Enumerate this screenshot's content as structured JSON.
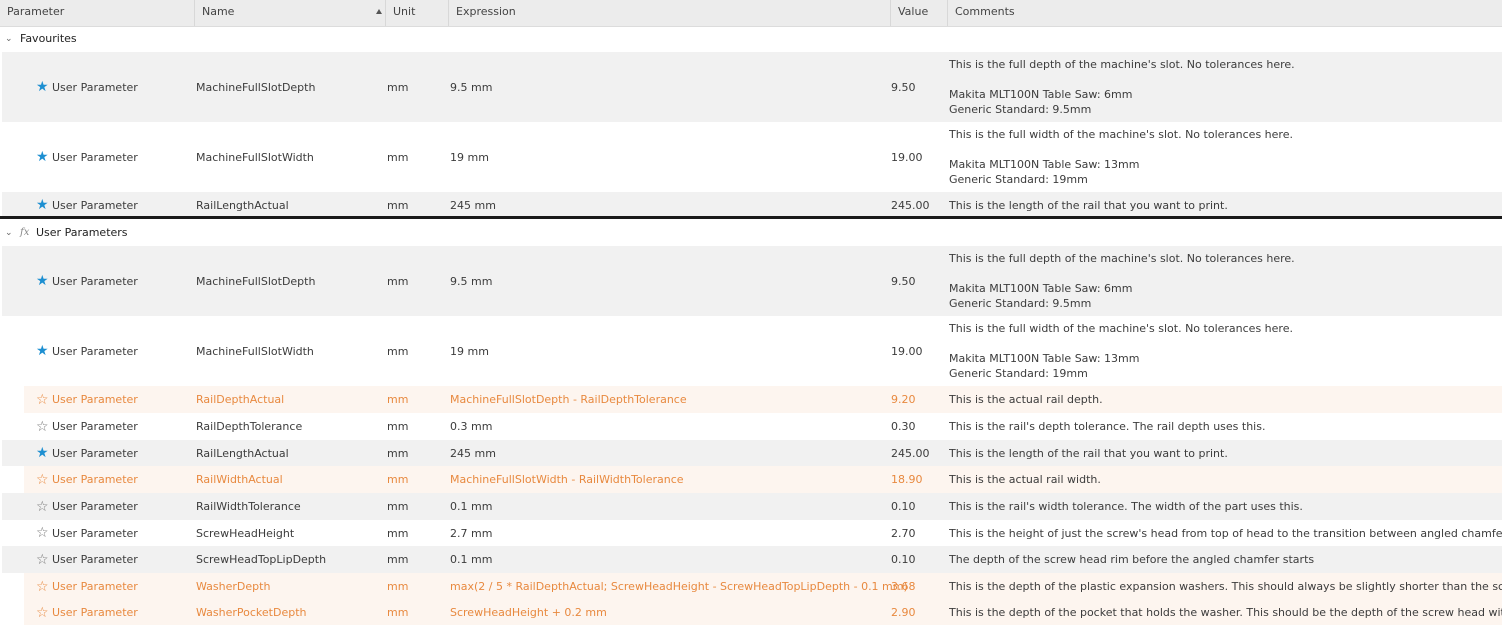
{
  "columns": [
    "Parameter",
    "Name",
    "Unit",
    "Expression",
    "Value",
    "Comments"
  ],
  "groups": [
    {
      "title": "Favourites",
      "rows": [
        {
          "style": "gray",
          "star": "filled",
          "param": "User Parameter",
          "name": "MachineFullSlotDepth",
          "unit": "mm",
          "expr": "9.5 mm",
          "value": "9.50",
          "comment": [
            "This is the full depth of the machine's slot. No tolerances here.",
            "",
            "Makita MLT100N Table Saw: 6mm",
            "Generic Standard: 9.5mm"
          ]
        },
        {
          "style": "white",
          "star": "filled",
          "param": "User Parameter",
          "name": "MachineFullSlotWidth",
          "unit": "mm",
          "expr": "19 mm",
          "value": "19.00",
          "comment": [
            "This is the full width of the machine's slot. No tolerances here.",
            "",
            "Makita MLT100N Table Saw: 13mm",
            "Generic Standard: 19mm"
          ]
        },
        {
          "style": "gray",
          "star": "filled",
          "param": "User Parameter",
          "name": "RailLengthActual",
          "unit": "mm",
          "expr": "245 mm",
          "value": "245.00",
          "comment": [
            "This is the length of the rail that you want to print."
          ]
        }
      ]
    },
    {
      "title": "User Parameters",
      "rows": [
        {
          "style": "gray",
          "star": "filled",
          "param": "User Parameter",
          "name": "MachineFullSlotDepth",
          "unit": "mm",
          "expr": "9.5 mm",
          "value": "9.50",
          "comment": [
            "This is the full depth of the machine's slot. No tolerances here.",
            "",
            "Makita MLT100N Table Saw: 6mm",
            "Generic Standard: 9.5mm"
          ]
        },
        {
          "style": "white",
          "star": "filled",
          "param": "User Parameter",
          "name": "MachineFullSlotWidth",
          "unit": "mm",
          "expr": "19 mm",
          "value": "19.00",
          "comment": [
            "This is the full width of the machine's slot. No tolerances here.",
            "",
            "Makita MLT100N Table Saw: 13mm",
            "Generic Standard: 19mm"
          ]
        },
        {
          "style": "peach",
          "star": "empty",
          "param": "User Parameter",
          "name": "RailDepthActual",
          "unit": "mm",
          "expr": "MachineFullSlotDepth - RailDepthTolerance",
          "value": "9.20",
          "comment": [
            "This is the actual rail depth."
          ]
        },
        {
          "style": "white",
          "star": "empty",
          "param": "User Parameter",
          "name": "RailDepthTolerance",
          "unit": "mm",
          "expr": "0.3 mm",
          "value": "0.30",
          "comment": [
            "This is the rail's depth tolerance. The rail depth uses this."
          ]
        },
        {
          "style": "gray",
          "star": "filled",
          "param": "User Parameter",
          "name": "RailLengthActual",
          "unit": "mm",
          "expr": "245 mm",
          "value": "245.00",
          "comment": [
            "This is the length of the rail that you want to print."
          ]
        },
        {
          "style": "peach",
          "star": "empty",
          "param": "User Parameter",
          "name": "RailWidthActual",
          "unit": "mm",
          "expr": "MachineFullSlotWidth - RailWidthTolerance",
          "value": "18.90",
          "comment": [
            "This is the actual rail width."
          ]
        },
        {
          "style": "gray",
          "star": "empty",
          "param": "User Parameter",
          "name": "RailWidthTolerance",
          "unit": "mm",
          "expr": "0.1 mm",
          "value": "0.10",
          "comment": [
            "This is the rail's width tolerance. The width of the part uses this."
          ]
        },
        {
          "style": "white",
          "star": "empty",
          "param": "User Parameter",
          "name": "ScrewHeadHeight",
          "unit": "mm",
          "expr": "2.7 mm",
          "value": "2.70",
          "comment": [
            "This is the height of just the screw's head from top of head to the transition between angled chamfer to the s"
          ]
        },
        {
          "style": "gray",
          "star": "empty",
          "param": "User Parameter",
          "name": "ScrewHeadTopLipDepth",
          "unit": "mm",
          "expr": "0.1 mm",
          "value": "0.10",
          "comment": [
            "The depth of the screw head rim before the angled chamfer starts"
          ]
        },
        {
          "style": "peach",
          "star": "empty",
          "param": "User Parameter",
          "name": "WasherDepth",
          "unit": "mm",
          "expr": "max(2 / 5 * RailDepthActual; ScrewHeadHeight - ScrewHeadTopLipDepth - 0.1 mm)",
          "value": "3.68",
          "comment": [
            "This is the depth of the plastic expansion washers. This should always be slightly shorter than the screw head"
          ]
        },
        {
          "style": "peach",
          "star": "empty",
          "param": "User Parameter",
          "name": "WasherPocketDepth",
          "unit": "mm",
          "expr": "ScrewHeadHeight + 0.2 mm",
          "value": "2.90",
          "comment": [
            "This is the depth of the pocket that holds the washer. This should be the depth of the screw head with a small"
          ]
        }
      ]
    }
  ]
}
